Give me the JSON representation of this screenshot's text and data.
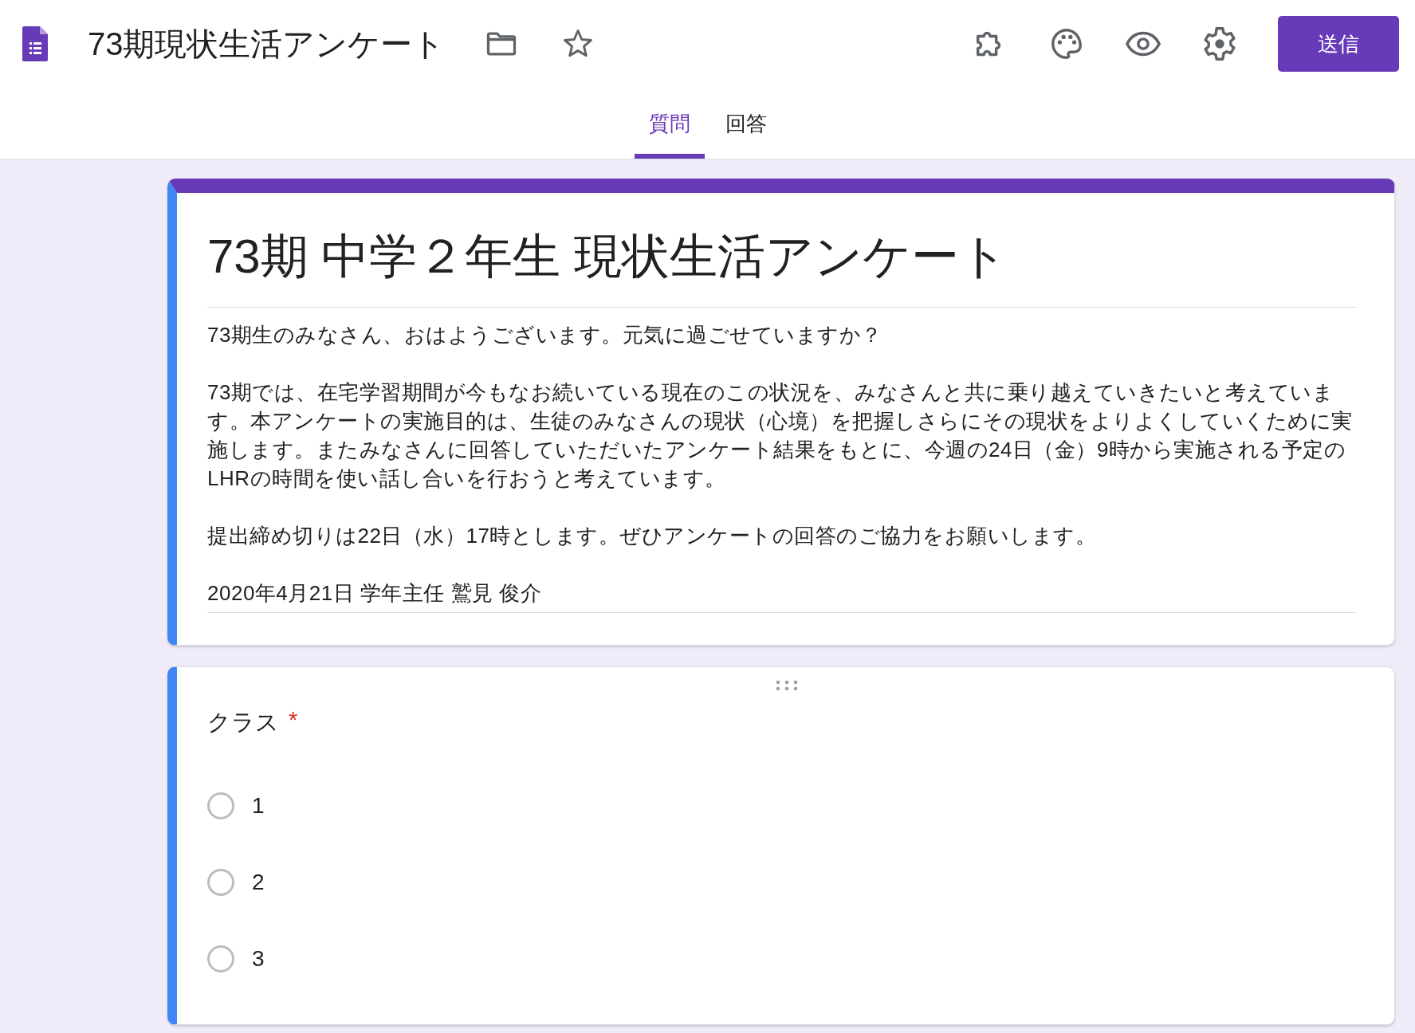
{
  "header": {
    "title": "73期現状生活アンケート",
    "send_button": "送信"
  },
  "tabs": [
    {
      "label": "質問",
      "selected": true
    },
    {
      "label": "回答",
      "selected": false
    }
  ],
  "form": {
    "title": "73期 中学２年生 現状生活アンケート",
    "description": [
      "73期生のみなさん、おはようございます。元気に過ごせていますか？",
      "73期では、在宅学習期間が今もなお続いている現在のこの状況を、みなさんと共に乗り越えていきたいと考えています。本アンケートの実施目的は、生徒のみなさんの現状（心境）を把握しさらにその現状をよりよくしていくために実施します。またみなさんに回答していただいたアンケート結果をもとに、今週の24日（金）9時から実施される予定のLHRの時間を使い話し合いを行おうと考えています。",
      "提出締め切りは22日（水）17時とします。ぜひアンケートの回答のご協力をお願いします。",
      "2020年4月21日 学年主任 鷲見 俊介"
    ]
  },
  "question": {
    "title": "クラス",
    "required": true,
    "required_mark": "*",
    "options": [
      {
        "label": "1",
        "selected": false
      },
      {
        "label": "2",
        "selected": false
      },
      {
        "label": "3",
        "selected": false
      }
    ]
  }
}
